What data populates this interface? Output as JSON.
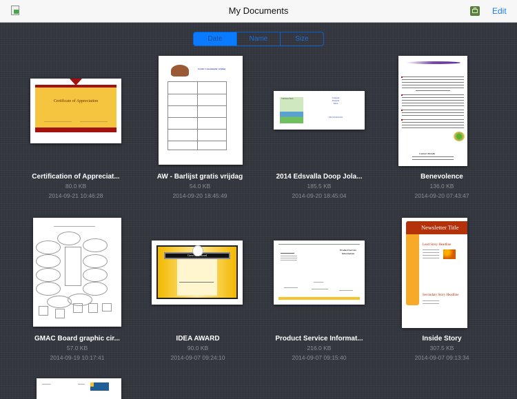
{
  "header": {
    "title": "My Documents",
    "edit_label": "Edit",
    "left_icon": "import-document-icon",
    "right_icon": "toolbox-icon"
  },
  "sort": {
    "options": [
      "Date",
      "Name",
      "Size"
    ],
    "selected": "Date",
    "accent": "#0a7bff"
  },
  "documents": [
    {
      "name": "Certification of Appreciat...",
      "size": "80.0 KB",
      "date": "2014-09-21 10:46:28",
      "thumb_text": "Certificate of Appreciation"
    },
    {
      "name": "AW - Barlijst gratis vrijdag",
      "size": "54.0 KB",
      "date": "2014-09-20 18:45:49",
      "thumb_text": "Gratis Consumptie vrijdag"
    },
    {
      "name": "2014 Edsvalla Doop Jola...",
      "size": "185.5 KB",
      "date": "2014-09-20 18:45:04",
      "thumb_text": "Världens Barn"
    },
    {
      "name": "Benevolence",
      "size": "136.0 KB",
      "date": "2014-09-20 07:43:47",
      "thumb_text": "Contact Details"
    },
    {
      "name": "GMAC Board graphic cir...",
      "size": "57.0 KB",
      "date": "2014-09-19 10:17:41",
      "thumb_text": ""
    },
    {
      "name": "IDEA AWARD",
      "size": "90.0 KB",
      "date": "2014-09-07 09:24:10",
      "thumb_text": "Great Idea Award"
    },
    {
      "name": "Product Service Informat...",
      "size": "216.0 KB",
      "date": "2014-09-07 09:15:40",
      "thumb_text": "Product/Service Information"
    },
    {
      "name": "Inside Story",
      "size": "307.5 KB",
      "date": "2014-09-07 09:13:34",
      "thumb_text": "Newsletter Title",
      "thumb_headline_1": "Lead Story Headline",
      "thumb_headline_2": "Secondary Story Headline"
    }
  ]
}
